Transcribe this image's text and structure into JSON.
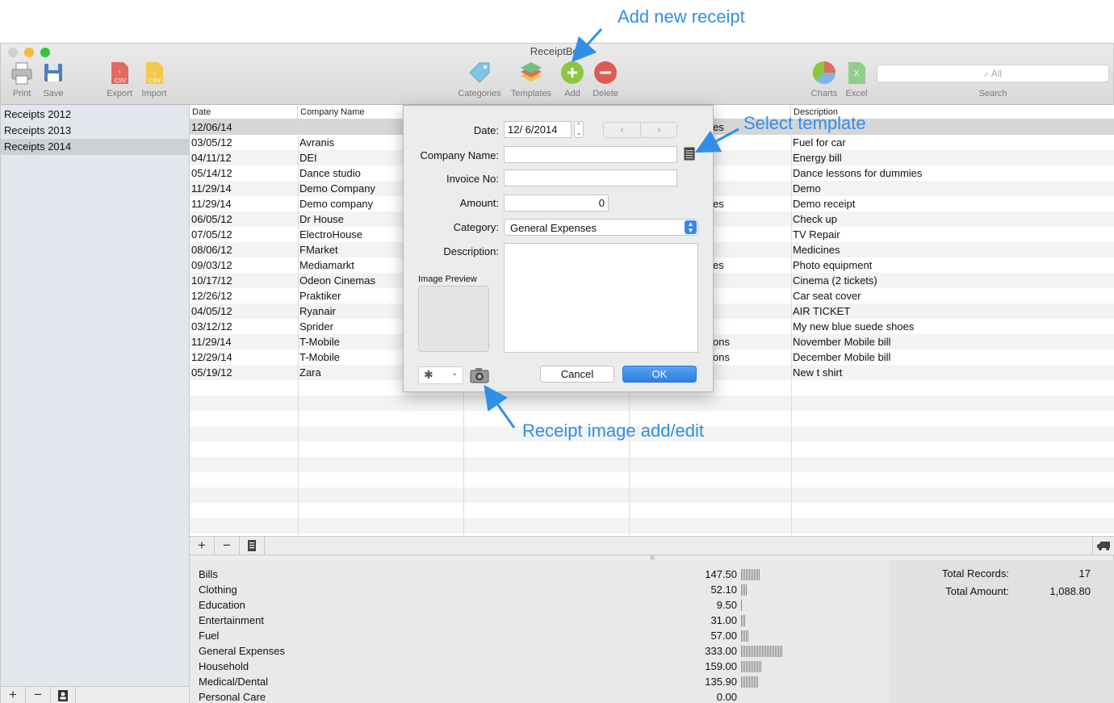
{
  "window": {
    "title": "ReceiptBox"
  },
  "toolbar": {
    "print": "Print",
    "save": "Save",
    "export": "Export",
    "import": "Import",
    "categories": "Categories",
    "templates": "Templates",
    "add": "Add",
    "delete": "Delete",
    "charts": "Charts",
    "excel": "Excel",
    "search_placeholder": "All",
    "search_label": "Search"
  },
  "sidebar": {
    "items": [
      "Receipts 2012",
      "Receipts 2013",
      "Receipts 2014"
    ],
    "selected": "Receipts 2014"
  },
  "table": {
    "columns": [
      "Date",
      "Company Name",
      "Description"
    ],
    "rows": [
      {
        "date": "12/06/14",
        "company": "",
        "col4": "es",
        "description": ""
      },
      {
        "date": "03/05/12",
        "company": "Avranis",
        "col4": "",
        "description": "Fuel for car"
      },
      {
        "date": "04/11/12",
        "company": "DEI",
        "col4": "",
        "description": "Energy bill"
      },
      {
        "date": "05/14/12",
        "company": "Dance studio",
        "col4": "",
        "description": "Dance lessons for dummies"
      },
      {
        "date": "11/29/14",
        "company": "Demo Company",
        "col4": "",
        "description": "Demo"
      },
      {
        "date": "11/29/14",
        "company": "Demo company",
        "col4": "es",
        "description": "Demo receipt"
      },
      {
        "date": "06/05/12",
        "company": "Dr House",
        "col4": "",
        "description": "Check up"
      },
      {
        "date": "07/05/12",
        "company": "ElectroHouse",
        "col4": "",
        "description": "TV Repair"
      },
      {
        "date": "08/06/12",
        "company": "FMarket",
        "col4": "",
        "description": "Medicines"
      },
      {
        "date": "09/03/12",
        "company": "Mediamarkt",
        "col4": "es",
        "description": "Photo equipment"
      },
      {
        "date": "10/17/12",
        "company": "Odeon Cinemas",
        "col4": "",
        "description": "Cinema (2 tickets)"
      },
      {
        "date": "12/26/12",
        "company": "Praktiker",
        "col4": "",
        "description": "Car seat cover"
      },
      {
        "date": "04/05/12",
        "company": "Ryanair",
        "col4": "",
        "description": "AIR TICKET"
      },
      {
        "date": "03/12/12",
        "company": "Sprider",
        "col4": "",
        "description": "My new blue suede shoes"
      },
      {
        "date": "11/29/14",
        "company": "T-Mobile",
        "col4": "ons",
        "description": "November Mobile bill"
      },
      {
        "date": "12/29/14",
        "company": "T-Mobile",
        "col4": "ons",
        "description": "December Mobile bill"
      },
      {
        "date": "05/19/12",
        "company": "Zara",
        "col4": "",
        "description": "New t shirt"
      }
    ]
  },
  "summary": {
    "categories": [
      {
        "name": "Bills",
        "amount": "147.50"
      },
      {
        "name": "Clothing",
        "amount": "52.10"
      },
      {
        "name": "Education",
        "amount": "9.50"
      },
      {
        "name": "Entertainment",
        "amount": "31.00"
      },
      {
        "name": "Fuel",
        "amount": "57.00"
      },
      {
        "name": "General Expenses",
        "amount": "333.00"
      },
      {
        "name": "Household",
        "amount": "159.00"
      },
      {
        "name": "Medical/Dental",
        "amount": "135.90"
      },
      {
        "name": "Personal Care",
        "amount": "0.00"
      }
    ],
    "total_records_label": "Total Records:",
    "total_records": "17",
    "total_amount_label": "Total Amount:",
    "total_amount": "1,088.80"
  },
  "dialog": {
    "date_label": "Date:",
    "date_value": "12/  6/2014",
    "company_label": "Company Name:",
    "company_value": "",
    "invoice_label": "Invoice No:",
    "invoice_value": "",
    "amount_label": "Amount:",
    "amount_value": "0",
    "category_label": "Category:",
    "category_value": "General Expenses",
    "description_label": "Description:",
    "image_preview_label": "Image Preview",
    "cancel": "Cancel",
    "ok": "OK"
  },
  "annotations": {
    "add_new": "Add new receipt",
    "select_template": "Select template",
    "receipt_image": "Receipt image add/edit"
  },
  "colors": {
    "accent": "#2f8fe8",
    "ok_button": "#2b7fe0",
    "add_icon": "#8cc63f",
    "delete_icon": "#e05a55"
  }
}
